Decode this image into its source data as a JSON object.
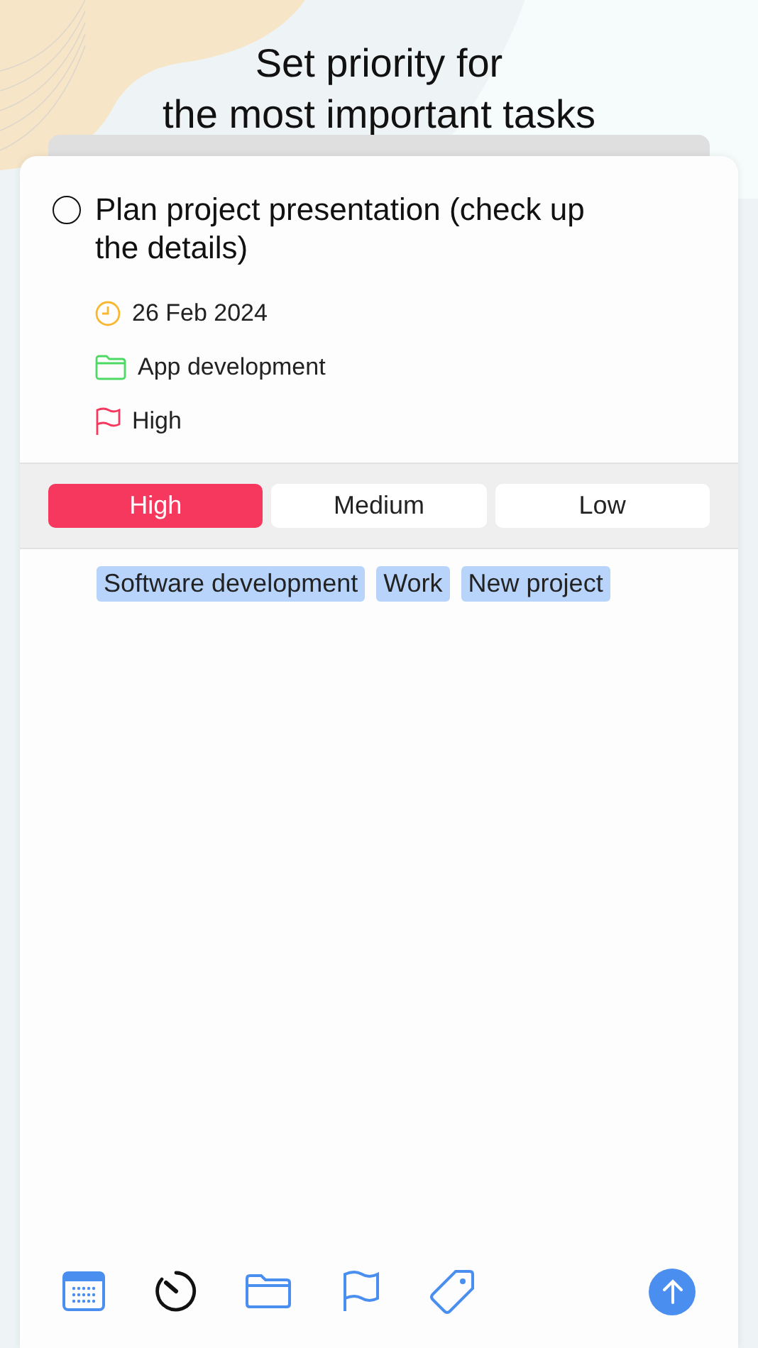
{
  "headline": [
    "Set priority for",
    "the most important tasks"
  ],
  "task": {
    "title": "Plan project presentation (check up the details)",
    "checked": false,
    "details": [
      {
        "kind": "date",
        "text": "26 Feb 2024"
      },
      {
        "kind": "project",
        "text": "App development"
      },
      {
        "kind": "priority",
        "text": "High"
      }
    ]
  },
  "priority_options": [
    {
      "label": "High",
      "selected": true
    },
    {
      "label": "Medium",
      "selected": false
    },
    {
      "label": "Low",
      "selected": false
    }
  ],
  "tags": [
    "Software development",
    "Work",
    "New project"
  ],
  "toolbar": [
    {
      "kind": "calendar",
      "selected": false
    },
    {
      "kind": "timer",
      "selected": true
    },
    {
      "kind": "folder",
      "selected": false
    },
    {
      "kind": "flag",
      "selected": false
    },
    {
      "kind": "tag",
      "selected": false
    }
  ]
}
